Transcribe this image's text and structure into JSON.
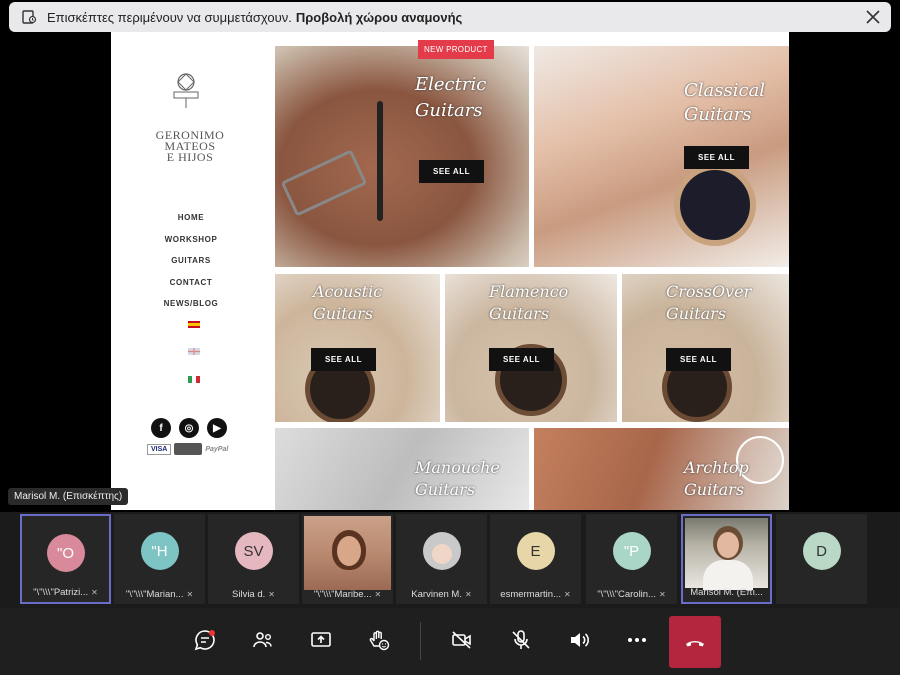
{
  "banner": {
    "message": "Επισκέπτες περιμένουν να συμμετάσχουν.",
    "link": "Προβολή χώρου αναμονής"
  },
  "shared_screen": {
    "brand": [
      "GERONIMO",
      "MATEOS",
      "E HIJOS"
    ],
    "nav": [
      "HOME",
      "WORKSHOP",
      "GUITARS",
      "CONTACT",
      "NEWS/BLOG"
    ],
    "badge": "NEW PRODUCT",
    "see_all": "SEE ALL",
    "payment": [
      "VISA",
      "PayPal"
    ],
    "tiles": [
      {
        "title": "Electric",
        "title2": "Guitars"
      },
      {
        "title": "Classical",
        "title2": "Guitars"
      },
      {
        "title": "Acoustic",
        "title2": "Guitars"
      },
      {
        "title": "Flamenco",
        "title2": "Guitars"
      },
      {
        "title": "CrossOver",
        "title2": "Guitars"
      },
      {
        "title": "Manouche",
        "title2": "Guitars"
      },
      {
        "title": "Archtop",
        "title2": "Guitars"
      }
    ]
  },
  "presenter_label": "Marisol M. (Επισκέπτης)",
  "participants": [
    {
      "initials": "\"O",
      "name": "\"\\\"\\\\\\\"Patrizi...",
      "color": "#d98a9a"
    },
    {
      "initials": "\"H",
      "name": "\"\\\"\\\\\\\"Marian...",
      "color": "#7fc4c4"
    },
    {
      "initials": "SV",
      "name": "Silvia d.",
      "color": "#e5b8bf"
    },
    {
      "initials": "",
      "name": "\"\\\"\\\\\\\"Maribe...",
      "color": ""
    },
    {
      "initials": "",
      "name": "Karvinen M.",
      "color": ""
    },
    {
      "initials": "E",
      "name": "esmermartin...",
      "color": "#e7d6a8"
    },
    {
      "initials": "\"P",
      "name": "\"\\\"\\\\\\\"Carolin...",
      "color": "#a9d6c6"
    },
    {
      "initials": "",
      "name": "Marisol M. (Επι...",
      "color": ""
    },
    {
      "initials": "D",
      "name": "",
      "color": "#b9d8c6"
    }
  ]
}
